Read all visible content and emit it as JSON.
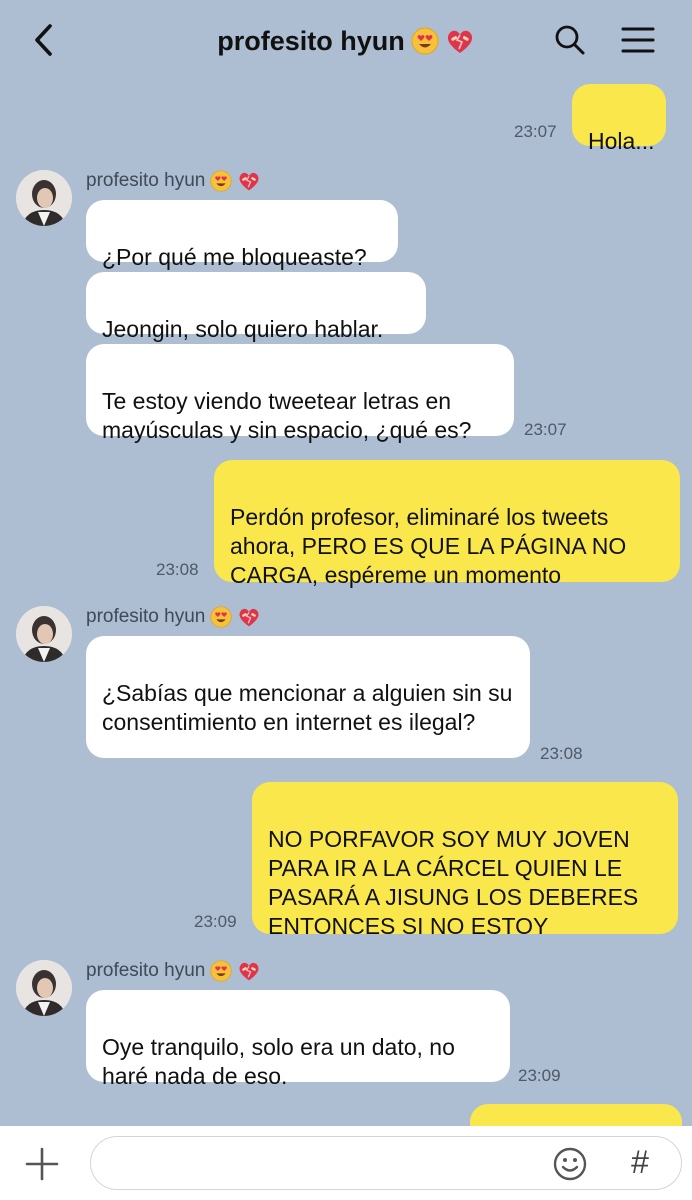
{
  "header": {
    "title": "profesito hyun",
    "title_emojis": [
      "heart-eyes-emoji",
      "mending-heart-emoji"
    ],
    "back_icon": "chevron-left-icon",
    "search_icon": "search-icon",
    "menu_icon": "hamburger-menu-icon"
  },
  "messages": [
    {
      "side": "out",
      "text": "Hola...",
      "time": "23:07"
    },
    {
      "side": "in",
      "sender": "profesito hyun",
      "text": "¿Por qué me bloqueaste?"
    },
    {
      "side": "in",
      "text": "Jeongin, solo quiero hablar."
    },
    {
      "side": "in",
      "text": "Te estoy viendo tweetear letras en mayúsculas y sin espacio, ¿qué es?",
      "time": "23:07"
    },
    {
      "side": "out",
      "text": "Perdón profesor, eliminaré los tweets ahora, PERO ES QUE LA PÁGINA NO CARGA, espéreme un momento",
      "time": "23:08"
    },
    {
      "side": "in",
      "sender": "profesito hyun",
      "text": "¿Sabías que mencionar a alguien sin su consentimiento en internet es ilegal?",
      "time": "23:08"
    },
    {
      "side": "out",
      "text": "NO PORFAVOR SOY MUY JOVEN PARA IR A LA CÁRCEL QUIEN LE PASARÁ A JISUNG LOS DEBERES ENTONCES SI NO ESTOY",
      "time": "23:09"
    },
    {
      "side": "in",
      "sender": "profesito hyun",
      "text": "Oye tranquilo, solo era un dato, no haré nada de eso.",
      "time": "23:09"
    }
  ],
  "input_bar": {
    "plus_icon": "plus-icon",
    "input_value": "",
    "emoji_icon": "smiley-icon",
    "hash_label": "#"
  },
  "colors": {
    "background": "#adbdd2",
    "incoming_bubble": "#ffffff",
    "outgoing_bubble": "#f9e74c"
  }
}
